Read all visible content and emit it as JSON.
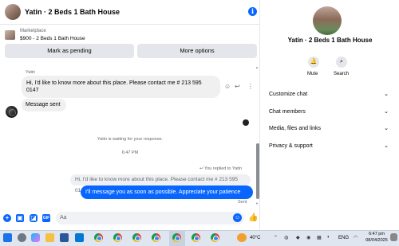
{
  "chat": {
    "title": "Yatin · 2 Beds 1 Bath House",
    "info_icon": "i"
  },
  "marketplace": {
    "label": "Marketplace",
    "item": "$900 - 2 Beds 1 Bath House",
    "mark_pending": "Mark as pending",
    "more_options": "More options"
  },
  "messages": {
    "sender": "Yatin",
    "incoming": "Hi, I'd like to know more about this place. Please contact me # 213 595 0147",
    "message_sent": "Message sent",
    "waiting": "Yatin is waiting for your response.",
    "time": "6:47 PM",
    "replied_to": "You replied to Yatin",
    "quoted": "Hi, I'd like to know more about this place. Please contact me # 213 595 0147",
    "outgoing": "I'll message you as soon as possible. Appreciate your patience",
    "sent_status": "Sent"
  },
  "composer": {
    "placeholder": "Aa",
    "gif_label": "GIF"
  },
  "panel": {
    "title": "Yatin · 2 Beds 1 Bath House",
    "mute": "Mute",
    "search": "Search",
    "rows": [
      "Customize chat",
      "Chat members",
      "Media, files and links",
      "Privacy & support"
    ]
  },
  "taskbar": {
    "temperature": "40°C",
    "language": "ENG",
    "time": "6:47 pm",
    "date": "08/04/2025"
  },
  "colors": {
    "accent": "#0866ff",
    "bubble_in": "#f0f0f0",
    "button_bg": "#e4e6eb"
  },
  "icons": {
    "info": "info-icon",
    "mute": "bell-icon",
    "search": "search-icon",
    "like": "thumbs-up-icon"
  }
}
